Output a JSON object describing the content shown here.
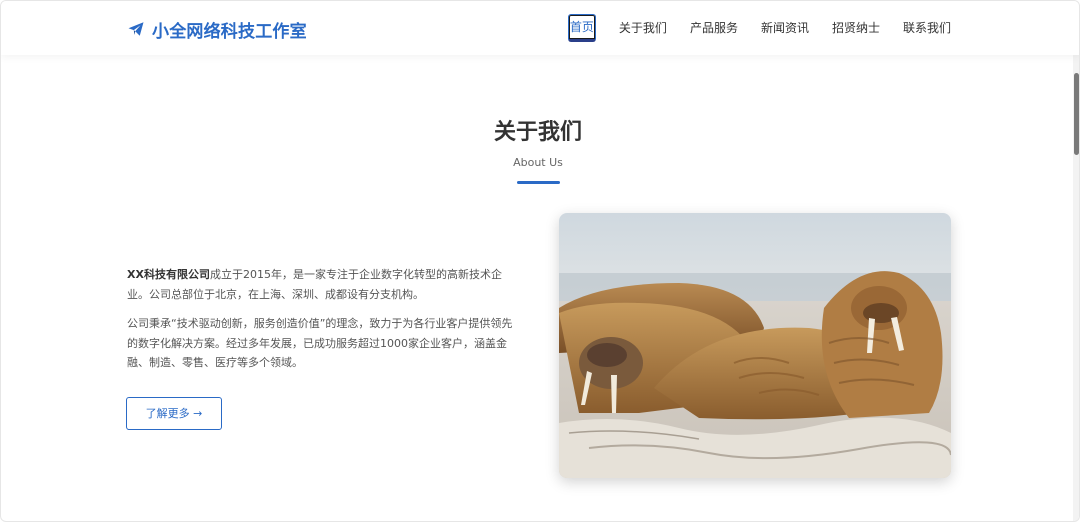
{
  "brand": {
    "name": "小全网络科技工作室",
    "color": "#2a6ac6",
    "icon": "paper-plane-icon"
  },
  "nav": {
    "items": [
      {
        "label": "首页",
        "active": true
      },
      {
        "label": "关于我们",
        "active": false
      },
      {
        "label": "产品服务",
        "active": false
      },
      {
        "label": "新闻资讯",
        "active": false
      },
      {
        "label": "招贤纳士",
        "active": false
      },
      {
        "label": "联系我们",
        "active": false
      }
    ]
  },
  "about": {
    "title": "关于我们",
    "subtitle": "About Us",
    "company": "XX科技有限公司",
    "paragraph1_rest": "成立于2015年，是一家专注于企业数字化转型的高新技术企业。公司总部位于北京，在上海、深圳、成都设有分支机构。",
    "paragraph2": "公司秉承“技术驱动创新，服务创造价值”的理念，致力于为各行业客户提供领先的数字化解决方案。经过多年发展，已成功服务超过1000家企业客户，涵盖金融、制造、零售、医疗等多个领域。",
    "button_label": "了解更多 →",
    "image_subject": "walruses on a beach"
  },
  "colors": {
    "accent": "#2a6ac6",
    "text": "#333333",
    "muted": "#555555"
  }
}
